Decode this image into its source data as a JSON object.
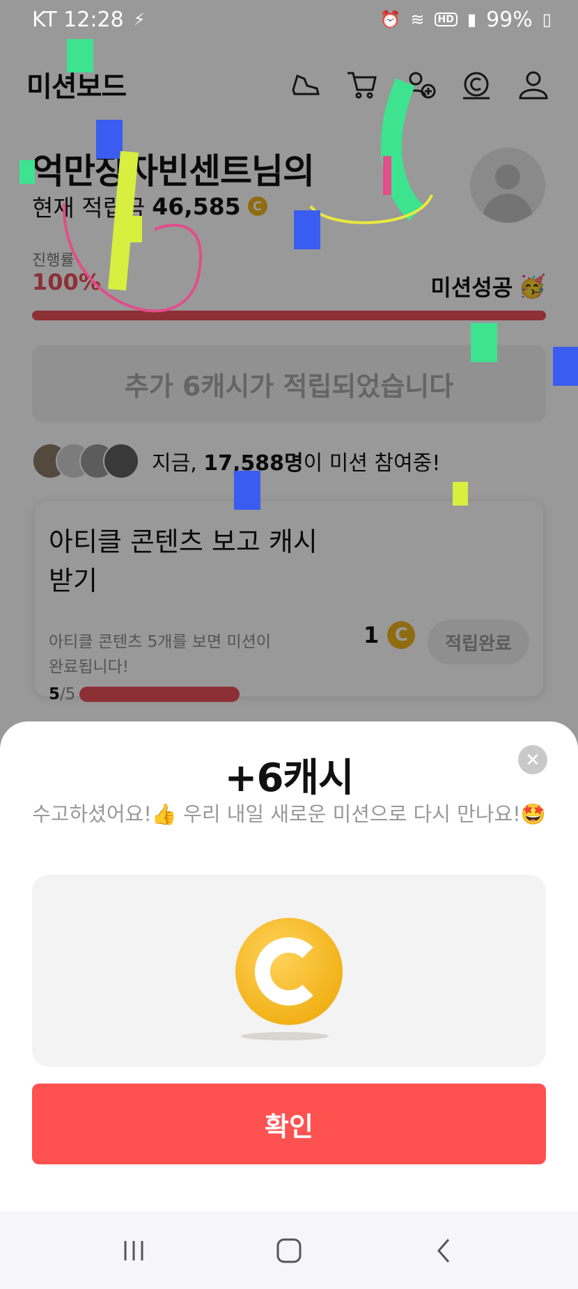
{
  "status_bar": {
    "carrier_time": "KT 12:28",
    "battery": "99%",
    "network_badge": "HD"
  },
  "header": {
    "title": "미션보드",
    "icons": [
      "shoe-icon",
      "cart-icon",
      "add-friend-icon",
      "cash-icon",
      "profile-icon"
    ]
  },
  "summary": {
    "greeting": "억만장자빈센트님의",
    "points_label": "현재 적립금",
    "points_value": "46,585",
    "coin_symbol": "C",
    "progress_label": "진행률",
    "progress_percent": "100%",
    "progress_fraction": 1.0,
    "status": "미션성공",
    "status_emoji": "🥳"
  },
  "bonus_banner": "추가 6캐시가 적립되었습니다",
  "participants": {
    "prefix": "지금, ",
    "count": "17,588명",
    "suffix": "이 미션 참여중!"
  },
  "mission_card": {
    "title": "아티클 콘텐츠 보고 캐시 받기",
    "description": "아티클 콘텐츠 5개를 보면 미션이 완료됩니다!",
    "done": "5",
    "total": "/5",
    "reward": "1",
    "button_label": "적립완료"
  },
  "sheet": {
    "title": "+6캐시",
    "message": "수고하셨어요!👍 우리 내일 새로운 미션으로 다시 만나요!🤩",
    "close_symbol": "✕",
    "confirm_label": "확인"
  },
  "colors": {
    "accent": "#ff5150",
    "progress": "#e9505a",
    "coin": "#f2b21a"
  }
}
